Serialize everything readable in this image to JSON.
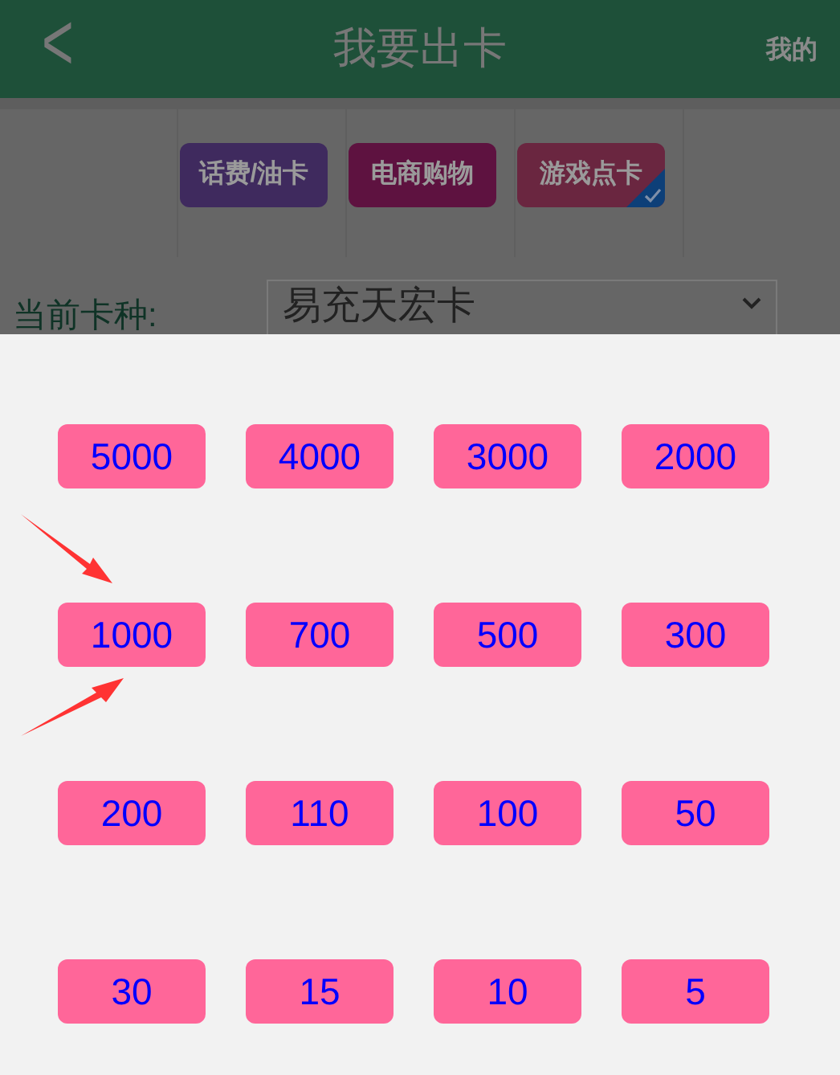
{
  "header": {
    "back": "<",
    "title": "我要出卡",
    "right": "我的"
  },
  "tabs": [
    {
      "label": "话费/油卡",
      "selected": false,
      "color": "#3f2a5e"
    },
    {
      "label": "电商购物",
      "selected": false,
      "color": "#5e1240"
    },
    {
      "label": "游戏点卡",
      "selected": true,
      "color": "#6a2640"
    }
  ],
  "card_type": {
    "label": "当前卡种:",
    "value": "易充天宏卡"
  },
  "amounts": [
    {
      "label": "5000",
      "highlighted": false
    },
    {
      "label": "4000",
      "highlighted": false
    },
    {
      "label": "3000",
      "highlighted": false
    },
    {
      "label": "2000",
      "highlighted": false
    },
    {
      "label": "1000",
      "highlighted": true
    },
    {
      "label": "700",
      "highlighted": false
    },
    {
      "label": "500",
      "highlighted": false
    },
    {
      "label": "300",
      "highlighted": false
    },
    {
      "label": "200",
      "highlighted": false
    },
    {
      "label": "110",
      "highlighted": false
    },
    {
      "label": "100",
      "highlighted": false
    },
    {
      "label": "50",
      "highlighted": false
    },
    {
      "label": "30",
      "highlighted": false
    },
    {
      "label": "15",
      "highlighted": false
    },
    {
      "label": "10",
      "highlighted": false
    },
    {
      "label": "5",
      "highlighted": false
    }
  ]
}
